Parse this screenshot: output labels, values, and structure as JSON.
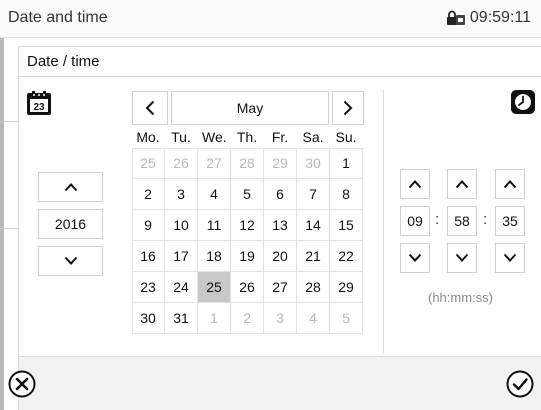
{
  "titlebar": {
    "title": "Date and time",
    "time": "09:59:11",
    "icon": "lock-icon"
  },
  "window": {
    "title": "Date / time"
  },
  "year": {
    "value": "2016",
    "up_icon": "chevron-up-icon",
    "down_icon": "chevron-down-icon"
  },
  "calendar": {
    "month": "May",
    "prev_icon": "chevron-left-icon",
    "next_icon": "chevron-right-icon",
    "weekdays": [
      "Mo.",
      "Tu.",
      "We.",
      "Th.",
      "Fr.",
      "Sa.",
      "Su."
    ],
    "weeks": [
      [
        "25",
        "26",
        "27",
        "28",
        "29",
        "30",
        "1"
      ],
      [
        "2",
        "3",
        "4",
        "5",
        "6",
        "7",
        "8"
      ],
      [
        "9",
        "10",
        "11",
        "12",
        "13",
        "14",
        "15"
      ],
      [
        "16",
        "17",
        "18",
        "19",
        "20",
        "21",
        "22"
      ],
      [
        "23",
        "24",
        "25",
        "26",
        "27",
        "28",
        "29"
      ],
      [
        "30",
        "31",
        "1",
        "2",
        "3",
        "4",
        "5"
      ]
    ],
    "selected_day": "25",
    "icon": "calendar-icon"
  },
  "time": {
    "hours": "09",
    "minutes": "58",
    "seconds": "35",
    "separator": ":",
    "format_hint": "(hh:mm:ss)",
    "icon": "clock-icon"
  },
  "footer": {
    "cancel_icon": "close-circle-icon",
    "confirm_icon": "check-circle-icon"
  },
  "colors": {
    "selected_day_bg": "#c8c8c8",
    "muted_text": "#b8b8b8",
    "bottom_bar": "#f2f2f2"
  }
}
